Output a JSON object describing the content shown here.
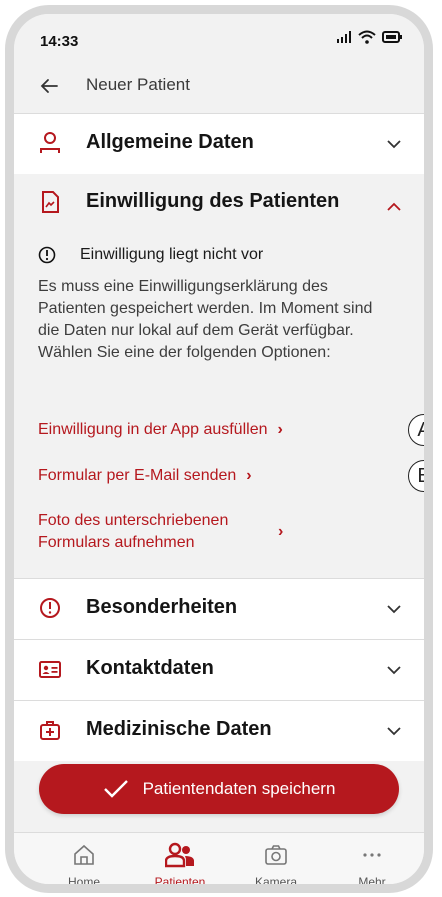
{
  "status": {
    "time": "14:33"
  },
  "appbar": {
    "title": "Neuer Patient"
  },
  "sections": {
    "general": {
      "title": "Allgemeine Daten"
    },
    "consent": {
      "title": "Einwilligung des Patienten",
      "warning": "Einwilligung liegt nicht vor",
      "description": "Es muss eine Einwilligungserklärung des Patienten gespeichert werden. Im Moment sind die Daten nur lokal auf dem Gerät verfügbar.",
      "instruction": "Wählen Sie eine der folgenden Optionen:",
      "options": [
        {
          "label": "Einwilligung in der App ausfüllen"
        },
        {
          "label": "Formular per E-Mail senden"
        },
        {
          "label": "Foto des unterschriebenen Formulars aufnehmen"
        }
      ]
    },
    "special": {
      "title": "Besonderheiten"
    },
    "contact": {
      "title": "Kontaktdaten"
    },
    "medical": {
      "title": "Medizinische Daten"
    }
  },
  "annotations": {
    "a": "A",
    "b": "B"
  },
  "save_button": {
    "label": "Patientendaten speichern"
  },
  "tabs": [
    {
      "label": "Home",
      "icon": "home-icon"
    },
    {
      "label": "Patienten",
      "icon": "patients-icon",
      "active": true
    },
    {
      "label": "Kamera",
      "icon": "camera-icon"
    },
    {
      "label": "Mehr",
      "icon": "more-icon"
    }
  ],
  "colors": {
    "accent": "#b5181e"
  }
}
